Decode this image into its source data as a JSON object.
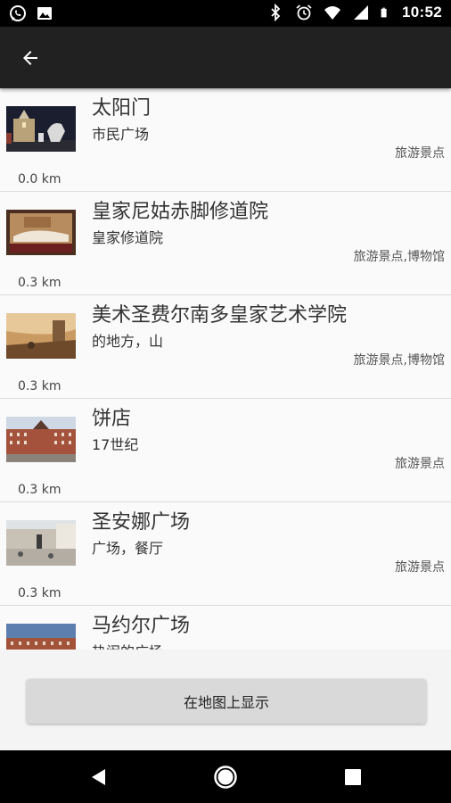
{
  "status_bar": {
    "time": "10:52",
    "left_icons": [
      "whatsapp-icon",
      "image-icon"
    ],
    "right_icons": [
      "bluetooth-icon",
      "alarm-icon",
      "wifi-icon",
      "signal-icon",
      "battery-icon"
    ]
  },
  "app_bar": {
    "back_icon": "arrow-left-icon"
  },
  "places": [
    {
      "name": "太阳门",
      "subtitle": "市民广场",
      "category": "旅游景点",
      "distance": "0.0 km"
    },
    {
      "name": "皇家尼姑赤脚修道院",
      "subtitle": "皇家修道院",
      "category": "旅游景点,博物馆",
      "distance": "0.3 km"
    },
    {
      "name": "美术圣费尔南多皇家艺术学院",
      "subtitle": "的地方，山",
      "category": "旅游景点,博物馆",
      "distance": "0.3 km"
    },
    {
      "name": "饼店",
      "subtitle": "17世纪",
      "category": "旅游景点",
      "distance": "0.3 km"
    },
    {
      "name": "圣安娜广场",
      "subtitle": "广场，餐厅",
      "category": "旅游景点",
      "distance": "0.3 km"
    },
    {
      "name": "马约尔广场",
      "subtitle": "热闹的广场",
      "category": "",
      "distance": ""
    }
  ],
  "map_button": {
    "label": "在地图上显示"
  },
  "nav_bar": {
    "icons": [
      "back-triangle-icon",
      "home-circle-icon",
      "recents-square-icon"
    ]
  }
}
